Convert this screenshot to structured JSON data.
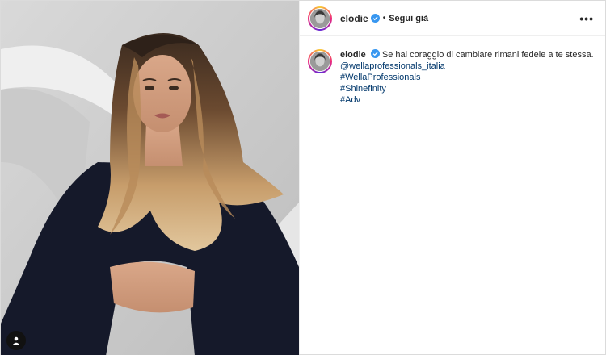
{
  "post": {
    "username": "elodie",
    "follow_label": "Segui già",
    "separator": "•",
    "more_label": "•••",
    "caption": {
      "username": "elodie",
      "text": "Se hai coraggio di cambiare rimani fedele a te stessa.",
      "links": [
        "@wellaprofessionals_italia",
        "#WellaProfessionals",
        "#Shinefinity",
        "#Adv"
      ]
    }
  },
  "colors": {
    "link": "#00376b",
    "verified": "#3897f0",
    "text": "#262626"
  }
}
